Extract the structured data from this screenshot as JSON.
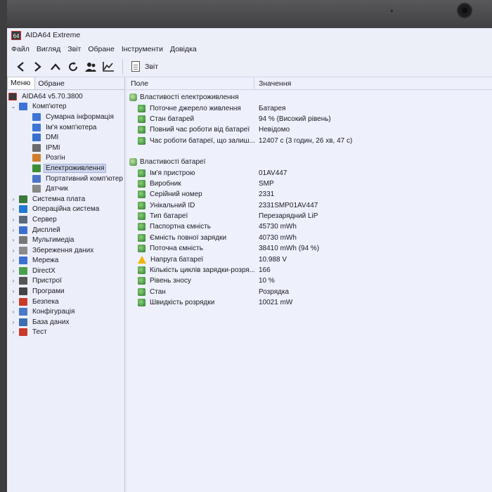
{
  "window": {
    "app_icon_text": "64",
    "title": "AIDA64 Extreme"
  },
  "menu": [
    "Файл",
    "Вигляд",
    "Звіт",
    "Обране",
    "Інструменти",
    "Довідка"
  ],
  "toolbar": {
    "report_label": "Звіт"
  },
  "left_tabs": {
    "menu": "Меню",
    "favorites": "Обране"
  },
  "tree": {
    "root": "AIDA64 v5.70.3800",
    "computer": "Комп'ютер",
    "computer_children": [
      {
        "label": "Сумарна інформація",
        "color": "#3d74d6"
      },
      {
        "label": "Ім'я комп'ютера",
        "color": "#3d74d6"
      },
      {
        "label": "DMI",
        "color": "#3a6fd0"
      },
      {
        "label": "IPMI",
        "color": "#6a6a6a"
      },
      {
        "label": "Розгін",
        "color": "#d0802a"
      },
      {
        "label": "Електроживлення",
        "color": "#3a8f35"
      },
      {
        "label": "Портативний комп'ютер",
        "color": "#4a74c8"
      },
      {
        "label": "Датчик",
        "color": "#888888"
      }
    ],
    "sections": [
      {
        "label": "Системна плата",
        "color": "#3a7a3a"
      },
      {
        "label": "Операційна система",
        "color": "#1f78d1"
      },
      {
        "label": "Сервер",
        "color": "#5a6a7a"
      },
      {
        "label": "Дисплей",
        "color": "#3b6fd0"
      },
      {
        "label": "Мультимедіа",
        "color": "#777777"
      },
      {
        "label": "Збереження даних",
        "color": "#8a8a8a"
      },
      {
        "label": "Мережа",
        "color": "#3b6fd0"
      },
      {
        "label": "DirectX",
        "color": "#4aa04a"
      },
      {
        "label": "Пристрої",
        "color": "#555555"
      },
      {
        "label": "Програми",
        "color": "#444444"
      },
      {
        "label": "Безпека",
        "color": "#c83a2a"
      },
      {
        "label": "Конфігурація",
        "color": "#4a7ac8"
      },
      {
        "label": "База даних",
        "color": "#3a6fb0"
      },
      {
        "label": "Тест",
        "color": "#c83a2a"
      }
    ]
  },
  "columns": {
    "field": "Поле",
    "value": "Значення"
  },
  "power_group": {
    "title": "Властивості електроживлення",
    "rows": [
      {
        "field": "Поточне джерело живлення",
        "value": "Батарея"
      },
      {
        "field": "Стан батарей",
        "value": "94 % (Високий рівень)"
      },
      {
        "field": "Повний час роботи від батареї",
        "value": "Невідомо"
      },
      {
        "field": "Час роботи батареї, що залиш...",
        "value": "12407 с (3 годин, 26 хв, 47 с)"
      }
    ]
  },
  "battery_group": {
    "title": "Властивості батареї",
    "rows": [
      {
        "field": "Ім'я пристрою",
        "value": "01AV447",
        "icon": "battery-icon"
      },
      {
        "field": "Виробник",
        "value": "SMP",
        "icon": "battery-icon"
      },
      {
        "field": "Серійний номер",
        "value": "2331",
        "icon": "battery-icon"
      },
      {
        "field": "Унікальний ID",
        "value": "2331SMP01AV447",
        "icon": "battery-icon"
      },
      {
        "field": "Тип батареї",
        "value": "Перезарядний LiP",
        "icon": "battery-icon"
      },
      {
        "field": "Паспортна ємність",
        "value": "45730 mWh",
        "icon": "battery-icon"
      },
      {
        "field": "Ємність повної зарядки",
        "value": "40730 mWh",
        "icon": "battery-icon"
      },
      {
        "field": "Поточна ємність",
        "value": "38410 mWh  (94 %)",
        "icon": "battery-icon"
      },
      {
        "field": "Напруга батареї",
        "value": "10.988 V",
        "icon": "warning-icon"
      },
      {
        "field": "Кількість циклів зарядки-розря...",
        "value": "166",
        "icon": "battery-icon"
      },
      {
        "field": "Рівень зносу",
        "value": "10 %",
        "icon": "battery-icon"
      },
      {
        "field": "Стан",
        "value": "Розрядка",
        "icon": "battery-icon"
      },
      {
        "field": "Швидкість розрядки",
        "value": "10021 mW",
        "icon": "battery-icon"
      }
    ]
  }
}
